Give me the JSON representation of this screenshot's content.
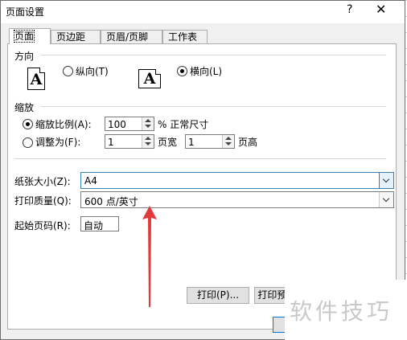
{
  "window": {
    "title": "页面设置",
    "help_glyph": "?",
    "close_glyph": "✕"
  },
  "tabs": [
    {
      "label": "页面",
      "active": true
    },
    {
      "label": "页边距",
      "active": false
    },
    {
      "label": "页眉/页脚",
      "active": false
    },
    {
      "label": "工作表",
      "active": false
    }
  ],
  "orientation": {
    "heading": "方向",
    "icon_letter": "A",
    "portrait_label": "纵向(T)",
    "landscape_label": "横向(L)",
    "selected": "landscape"
  },
  "scaling": {
    "heading": "缩放",
    "adjust_label": "缩放比例(A):",
    "adjust_value": "100",
    "adjust_suffix": "% 正常尺寸",
    "fit_label": "调整为(F):",
    "fit_wide_value": "1",
    "fit_wide_suffix": "页宽",
    "fit_tall_value": "1",
    "fit_tall_suffix": "页高",
    "selected": "adjust"
  },
  "paper_size": {
    "label": "纸张大小(Z):",
    "value": "A4"
  },
  "print_quality": {
    "label": "打印质量(Q):",
    "value": "600 点/英寸"
  },
  "first_page": {
    "label": "起始页码(R):",
    "value": "自动"
  },
  "buttons": {
    "print": "打印(P)...",
    "print_preview": "打印预览(W)"
  },
  "watermark": "软件技巧",
  "colors": {
    "accent": "#3c7fb1",
    "arrow": "#e03a3a"
  }
}
